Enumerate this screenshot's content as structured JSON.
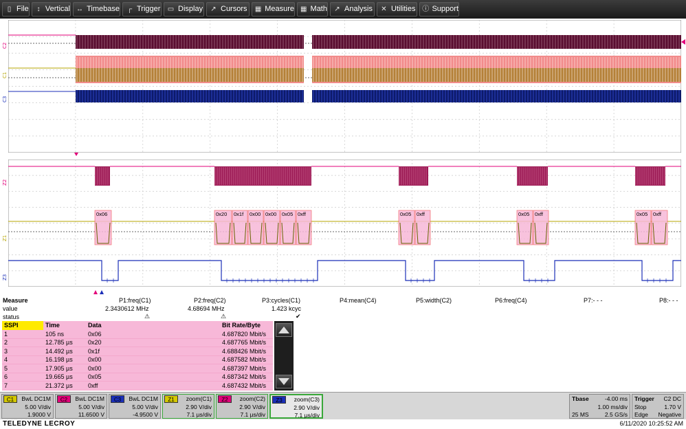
{
  "menu": {
    "items": [
      {
        "label": "File",
        "icon": "file-icon"
      },
      {
        "label": "Vertical",
        "icon": "vertical-icon"
      },
      {
        "label": "Timebase",
        "icon": "timebase-icon"
      },
      {
        "label": "Trigger",
        "icon": "trigger-icon"
      },
      {
        "label": "Display",
        "icon": "display-icon"
      },
      {
        "label": "Cursors",
        "icon": "cursors-icon"
      },
      {
        "label": "Measure",
        "icon": "measure-icon"
      },
      {
        "label": "Math",
        "icon": "math-icon"
      },
      {
        "label": "Analysis",
        "icon": "analysis-icon"
      },
      {
        "label": "Utilities",
        "icon": "utilities-icon"
      },
      {
        "label": "Support",
        "icon": "support-icon"
      }
    ]
  },
  "colors": {
    "c1": "#b5a400",
    "c2": "#e3007a",
    "c3": "#1b2fb8",
    "z1": "#d4c800",
    "z2": "#e3007a",
    "z3": "#1b2fb8",
    "decode_box": "#f7b8d8",
    "decode_border": "#e55"
  },
  "channel_labels": {
    "c2": "C2",
    "c1": "C1",
    "c3": "C3",
    "z2": "Z2",
    "z1": "Z1",
    "z3": "Z3"
  },
  "decode_labels": [
    "0x06",
    "0x20",
    "0x1f",
    "0x00",
    "0x00",
    "0x05",
    "0xff",
    "0x05",
    "0xff",
    "0x05",
    "0xff",
    "0x05",
    "0xff"
  ],
  "measure": {
    "title": "Measure",
    "row_value": "value",
    "row_status": "status",
    "params": [
      {
        "name": "P1:freq(C1)",
        "value": "2.3430612 MHz",
        "status": "warning"
      },
      {
        "name": "P2:freq(C2)",
        "value": "4.68694 MHz",
        "status": "warning"
      },
      {
        "name": "P3:cycles(C1)",
        "value": "1.423 kcyc",
        "status": "check"
      },
      {
        "name": "P4:mean(C4)",
        "value": "",
        "status": ""
      },
      {
        "name": "P5:width(C2)",
        "value": "",
        "status": ""
      },
      {
        "name": "P6:freq(C4)",
        "value": "",
        "status": ""
      },
      {
        "name": "P7:- - -",
        "value": "",
        "status": ""
      },
      {
        "name": "P8:- - -",
        "value": "",
        "status": ""
      }
    ]
  },
  "spi_table": {
    "headers": [
      "SSPI",
      "Time",
      "Data",
      "Bit Rate/Byte"
    ],
    "rows": [
      [
        "1",
        "105 ns",
        "0x06",
        "4.687820 Mbit/s"
      ],
      [
        "2",
        "12.785 µs",
        "0x20",
        "4.687765 Mbit/s"
      ],
      [
        "3",
        "14.492 µs",
        "0x1f",
        "4.688426 Mbit/s"
      ],
      [
        "4",
        "16.198 µs",
        "0x00",
        "4.687582 Mbit/s"
      ],
      [
        "5",
        "17.905 µs",
        "0x00",
        "4.687397 Mbit/s"
      ],
      [
        "6",
        "19.665 µs",
        "0x05",
        "4.687342 Mbit/s"
      ],
      [
        "7",
        "21.372 µs",
        "0xff",
        "4.687432 Mbit/s"
      ]
    ]
  },
  "channels": [
    {
      "tag": "C1",
      "coupling": "BwL DC1M",
      "scale": "5.00 V/div",
      "offset": "1.9000 V",
      "tag_color": "#d4c800"
    },
    {
      "tag": "C2",
      "coupling": "BwL DC1M",
      "scale": "5.00 V/div",
      "offset": "11.6500 V",
      "tag_color": "#e3007a"
    },
    {
      "tag": "C3",
      "coupling": "BwL DC1M",
      "scale": "5.00 V/div",
      "offset": "-4.9500 V",
      "tag_color": "#1b2fb8"
    },
    {
      "tag": "Z1",
      "coupling": "zoom(C1)",
      "scale": "2.90 V/div",
      "offset": "7.1 µs/div",
      "tag_color": "#d4c800"
    },
    {
      "tag": "Z2",
      "coupling": "zoom(C2)",
      "scale": "2.90 V/div",
      "offset": "7.1 µs/div",
      "tag_color": "#e3007a"
    },
    {
      "tag": "Z3",
      "coupling": "zoom(C3)",
      "scale": "2.90 V/div",
      "offset": "7.1 µs/div",
      "tag_color": "#1b2fb8"
    }
  ],
  "timebase": {
    "label": "Tbase",
    "delay": "-4.00 ms",
    "div": "1.00 ms/div",
    "samples": "25 MS",
    "rate": "2.5 GS/s"
  },
  "trigger": {
    "label": "Trigger",
    "source": "C2 DC",
    "mode": "Stop",
    "level": "1.70 V",
    "type": "Edge",
    "slope": "Negative"
  },
  "status_bar": {
    "brand": "TELEDYNE LECROY",
    "datetime": "6/11/2020 10:25:52 AM"
  }
}
